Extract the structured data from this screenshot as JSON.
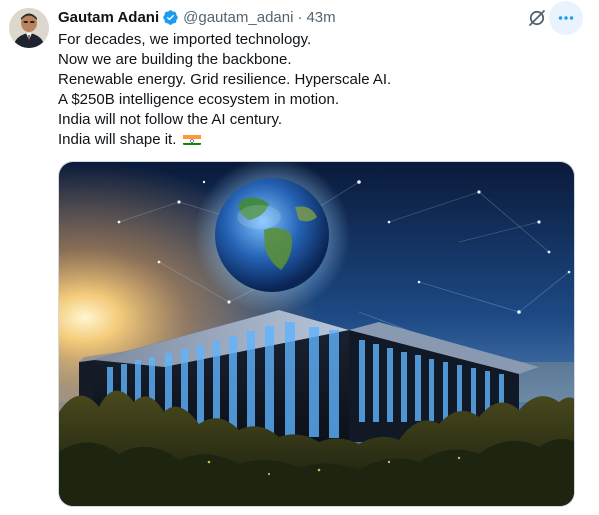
{
  "author": {
    "name": "Gautam Adani",
    "handle": "@gautam_adani",
    "separator": "·",
    "time": "43m",
    "verified": true
  },
  "tweet": {
    "lines": [
      "For decades, we imported technology.",
      "Now we are building the backbone.",
      "Renewable energy. Grid resilience. Hyperscale AI.",
      "A $250B intelligence ecosystem in motion.",
      "India will not follow the AI century.",
      "India will shape it."
    ],
    "emoji": "india-flag"
  },
  "icons": {
    "grok": "grok-icon",
    "more": "more-icon",
    "verified": "verified-badge-icon"
  },
  "colors": {
    "verified_blue": "#1d9bf0",
    "secondary_text": "#536471",
    "hover_bg": "#e8f3fd"
  }
}
